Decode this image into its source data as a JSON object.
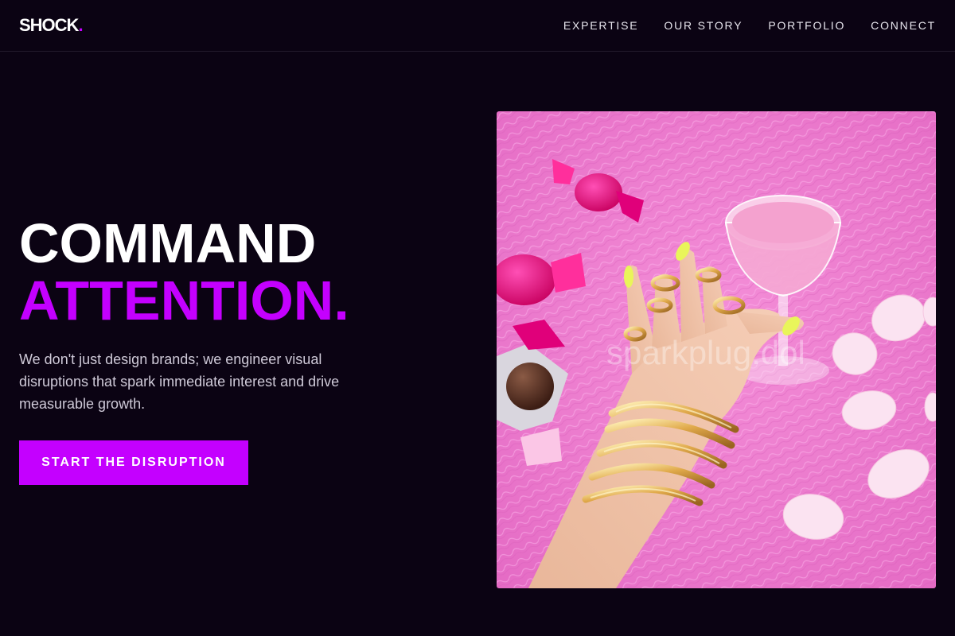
{
  "brand": {
    "name": "SHOCK",
    "dot": ".",
    "accent": "#c400ff"
  },
  "nav": {
    "items": [
      {
        "label": "EXPERTISE"
      },
      {
        "label": "OUR STORY"
      },
      {
        "label": "PORTFOLIO"
      },
      {
        "label": "CONNECT"
      }
    ]
  },
  "hero": {
    "title_line1": "COMMAND",
    "title_line2": "ATTENTION.",
    "body": "We don't just design brands; we engineer visual disruptions that spark immediate interest and drive measurable growth.",
    "cta_label": "START THE DISRUPTION",
    "image_watermark": "sparkplug.dol",
    "image_alt": "Hand with gold chain bracelets and rings holding a pink cocktail glass on pink fur with wrapped candies and petals"
  },
  "colors": {
    "background": "#0b0313",
    "accent": "#c400ff",
    "text": "#ffffff",
    "muted_text": "#cfcad8",
    "image_fur": "#f07fd0"
  }
}
